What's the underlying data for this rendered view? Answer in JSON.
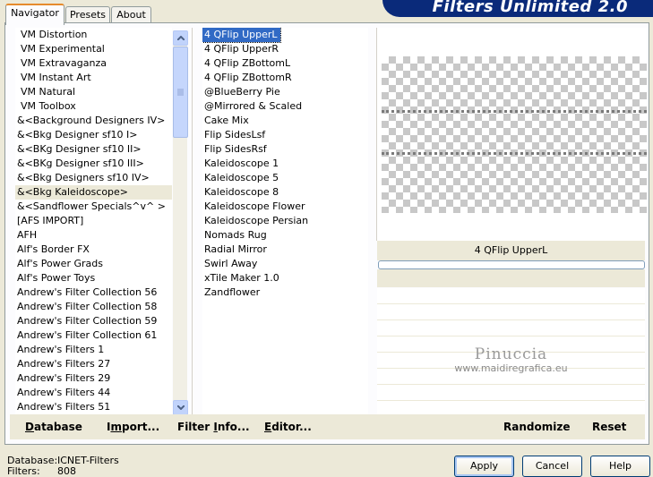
{
  "banner": {
    "title": "Filters Unlimited 2.0"
  },
  "tabs": [
    {
      "label": "Navigator",
      "active": true
    },
    {
      "label": "Presets",
      "active": false
    },
    {
      "label": "About",
      "active": false
    }
  ],
  "categories": [
    {
      "label": "VM Distortion",
      "indent": true
    },
    {
      "label": "VM Experimental",
      "indent": true
    },
    {
      "label": "VM Extravaganza",
      "indent": true
    },
    {
      "label": "VM Instant Art",
      "indent": true
    },
    {
      "label": "VM Natural",
      "indent": true
    },
    {
      "label": "VM Toolbox",
      "indent": true
    },
    {
      "label": "&<Background Designers IV>",
      "indent": false
    },
    {
      "label": "&<Bkg Designer sf10 I>",
      "indent": false
    },
    {
      "label": "&<BKg Designer sf10 II>",
      "indent": false
    },
    {
      "label": "&<BKg Designer sf10 III>",
      "indent": false
    },
    {
      "label": "&<Bkg Designers sf10 IV>",
      "indent": false
    },
    {
      "label": "&<Bkg Kaleidoscope>",
      "indent": false,
      "selected": true
    },
    {
      "label": "&<Sandflower Specials^v^ >",
      "indent": false
    },
    {
      "label": "[AFS IMPORT]",
      "indent": false
    },
    {
      "label": "AFH",
      "indent": false
    },
    {
      "label": "Alf's Border FX",
      "indent": false
    },
    {
      "label": "Alf's Power Grads",
      "indent": false
    },
    {
      "label": "Alf's Power Toys",
      "indent": false
    },
    {
      "label": "Andrew's Filter Collection 56",
      "indent": false
    },
    {
      "label": "Andrew's Filter Collection 58",
      "indent": false
    },
    {
      "label": "Andrew's Filter Collection 59",
      "indent": false
    },
    {
      "label": "Andrew's Filter Collection 61",
      "indent": false
    },
    {
      "label": "Andrew's Filters 1",
      "indent": false
    },
    {
      "label": "Andrew's Filters 27",
      "indent": false
    },
    {
      "label": "Andrew's Filters 29",
      "indent": false
    },
    {
      "label": "Andrew's Filters 44",
      "indent": false
    },
    {
      "label": "Andrew's Filters 51",
      "indent": false
    }
  ],
  "filters": [
    {
      "label": "4 QFlip UpperL",
      "selected": true
    },
    {
      "label": "4 QFlip UpperR"
    },
    {
      "label": "4 QFlip ZBottomL"
    },
    {
      "label": "4 QFlip ZBottomR"
    },
    {
      "label": "@BlueBerry Pie"
    },
    {
      "label": "@Mirrored & Scaled"
    },
    {
      "label": "Cake Mix"
    },
    {
      "label": "Flip SidesLsf"
    },
    {
      "label": "Flip SidesRsf"
    },
    {
      "label": "Kaleidoscope 1"
    },
    {
      "label": "Kaleidoscope 5"
    },
    {
      "label": "Kaleidoscope 8"
    },
    {
      "label": "Kaleidoscope Flower"
    },
    {
      "label": "Kaleidoscope Persian"
    },
    {
      "label": "Nomads Rug"
    },
    {
      "label": "Radial Mirror"
    },
    {
      "label": "Swirl Away"
    },
    {
      "label": "xTile Maker 1.0"
    },
    {
      "label": "Zandflower"
    }
  ],
  "preview": {
    "filter_name": "4 QFlip UpperL",
    "watermark_name": "Pinuccia",
    "watermark_url": "www.maidiregrafica.eu"
  },
  "toolbar": {
    "database_first": "D",
    "database_rest": "atabase",
    "import_prefix": "I",
    "import_u": "m",
    "import_rest": "port...",
    "filterinfo_prefix": "Filter ",
    "filterinfo_u": "I",
    "filterinfo_rest": "nfo...",
    "editor_first": "E",
    "editor_rest": "ditor...",
    "randomize": "Randomize",
    "reset": "Reset"
  },
  "status": {
    "database_label": "Database:",
    "database_value": "ICNET-Filters",
    "filters_label": "Filters:",
    "filters_value": "808"
  },
  "buttons": {
    "apply": "Apply",
    "cancel": "Cancel",
    "help": "Help"
  }
}
